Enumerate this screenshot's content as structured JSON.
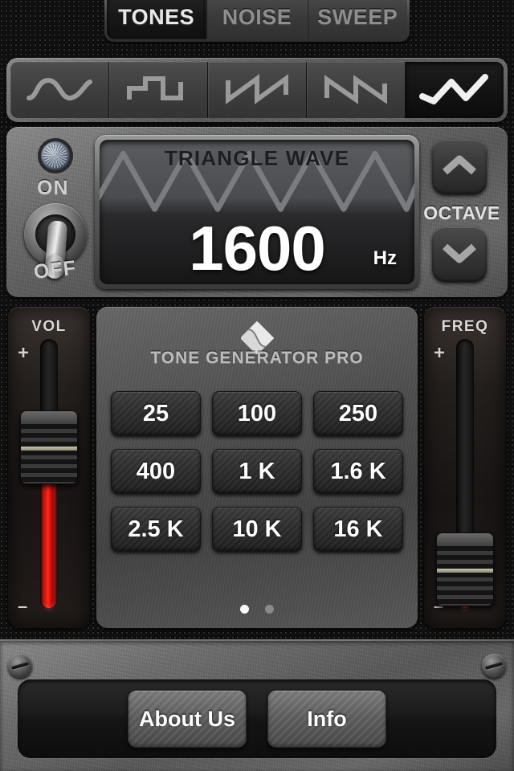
{
  "tabs": [
    {
      "label": "TONES",
      "active": true
    },
    {
      "label": "NOISE",
      "active": false
    },
    {
      "label": "SWEEP",
      "active": false
    }
  ],
  "waveforms": [
    {
      "name": "sine-wave",
      "active": false
    },
    {
      "name": "square-wave",
      "active": false
    },
    {
      "name": "sawtooth-up-wave",
      "active": false
    },
    {
      "name": "sawtooth-down-wave",
      "active": false
    },
    {
      "name": "triangle-wave",
      "active": true
    }
  ],
  "power": {
    "on_label": "ON",
    "off_label": "OFF",
    "state": "OFF",
    "led_icon": "led-indicator-icon",
    "switch_icon": "toggle-switch-icon"
  },
  "display": {
    "wave_name": "TRIANGLE WAVE",
    "frequency": "1600",
    "unit": "Hz",
    "waveform_icon": "triangle-wave-icon"
  },
  "octave": {
    "label": "OCTAVE",
    "up_icon": "chevron-up-icon",
    "down_icon": "chevron-down-icon"
  },
  "volume_slider": {
    "label": "VOL",
    "plus": "+",
    "minus": "–",
    "thumb_percent": 40,
    "fill_color": "#ff2b1d"
  },
  "frequency_slider": {
    "label": "FREQ",
    "plus": "+",
    "minus": "–",
    "thumb_percent": 85,
    "fill_color": "#ff2b1d"
  },
  "branding": {
    "name": "TONE GENERATOR PRO",
    "logo_icon": "diamond-logo-icon"
  },
  "presets": [
    {
      "label": "25"
    },
    {
      "label": "100"
    },
    {
      "label": "250"
    },
    {
      "label": "400"
    },
    {
      "label": "1 K"
    },
    {
      "label": "1.6 K"
    },
    {
      "label": "2.5 K"
    },
    {
      "label": "10 K"
    },
    {
      "label": "16 K"
    }
  ],
  "pager": {
    "count": 2,
    "active_index": 0
  },
  "bottom": {
    "about_label": "About Us",
    "info_label": "Info",
    "screw_icon": "screw-icon"
  },
  "colors": {
    "accent_red": "#ff2b1d",
    "panel_metal": "#6e6e6e",
    "text_light": "#ffffff",
    "text_dim": "#8e8e8e"
  }
}
